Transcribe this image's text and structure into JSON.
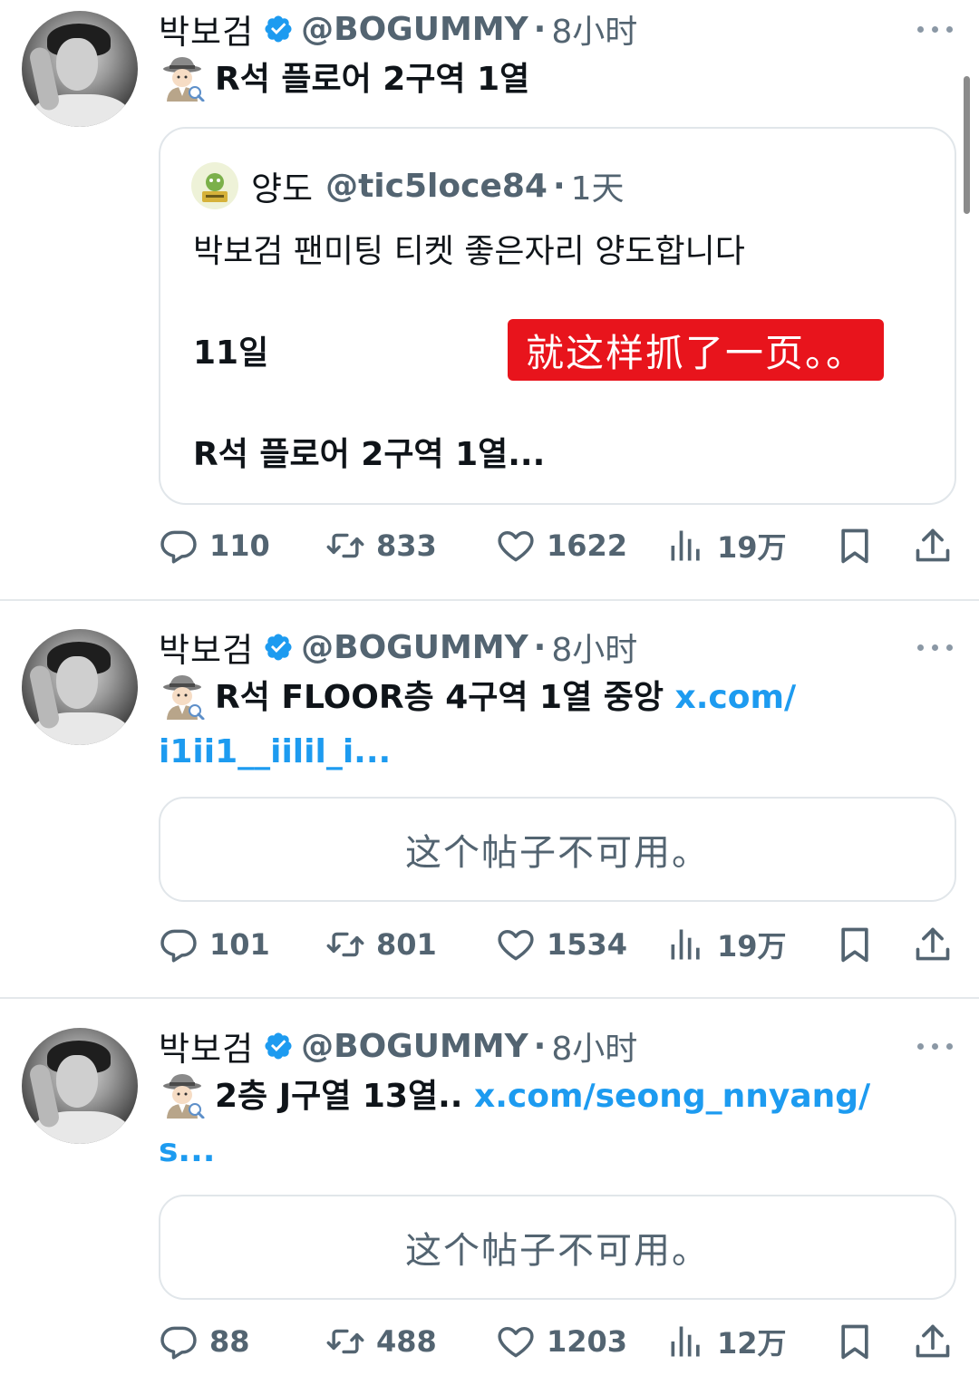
{
  "colors": {
    "link": "#1d9bf0",
    "muted": "#536471",
    "verified": "#1d9bf0",
    "overlay": "#e8141c"
  },
  "tweets": [
    {
      "author": {
        "display_name": "박보검",
        "handle": "@BOGUMMY",
        "time": "8小时"
      },
      "text": "R석 플로어 2구역 1열",
      "quote": {
        "display_name": "양도",
        "handle": "@tic5loce84",
        "time": "1天",
        "line1": "박보검 팬미팅 티켓 좋은자리 양도합니다",
        "line2": "11일",
        "line3": "R석 플로어 2구역 1열..."
      },
      "stats": {
        "replies": "110",
        "retweets": "833",
        "likes": "1622",
        "views": "19万"
      }
    },
    {
      "author": {
        "display_name": "박보검",
        "handle": "@BOGUMMY",
        "time": "8小时"
      },
      "text": "R석 FLOOR층 4구역 1열 중앙",
      "link": "x.com/",
      "link2": "i1ii1__iilil_i...",
      "unavailable": "这个帖子不可用。",
      "stats": {
        "replies": "101",
        "retweets": "801",
        "likes": "1534",
        "views": "19万"
      }
    },
    {
      "author": {
        "display_name": "박보검",
        "handle": "@BOGUMMY",
        "time": "8小时"
      },
      "text": "2층 J구열 13열..",
      "link": "x.com/seong_nnyang/",
      "link2": "s...",
      "unavailable": "这个帖子不可用。",
      "stats": {
        "replies": "88",
        "retweets": "488",
        "likes": "1203",
        "views": "12万"
      }
    }
  ],
  "overlay_caption": "就这样抓了一页。。",
  "icons": [
    "verified-icon",
    "more-icon",
    "detective-emoji",
    "reply-icon",
    "retweet-icon",
    "like-icon",
    "views-icon",
    "bookmark-icon",
    "share-icon"
  ]
}
